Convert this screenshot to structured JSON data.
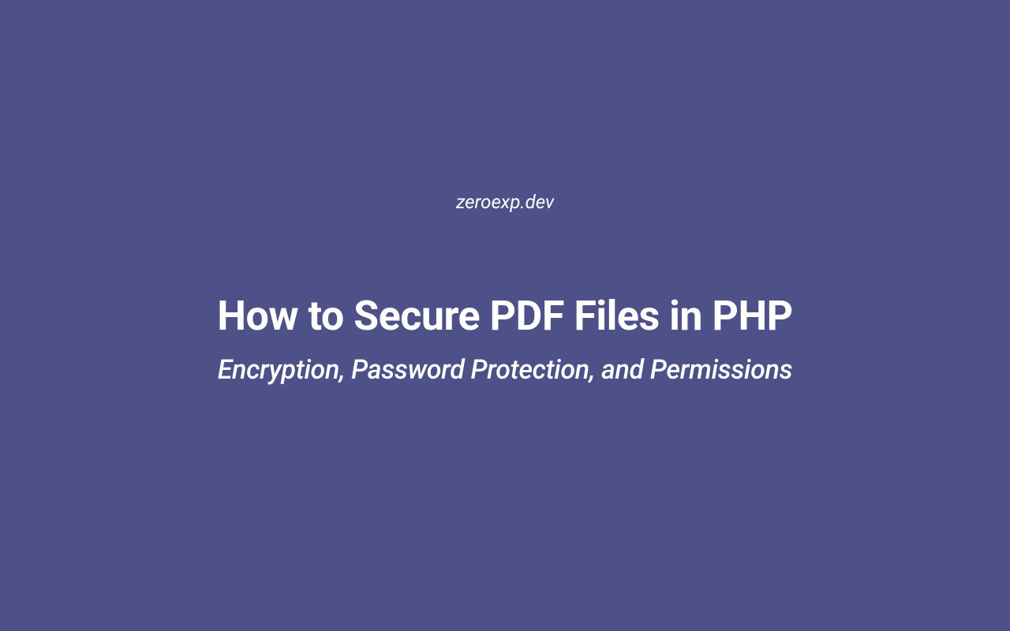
{
  "site_name": "zeroexp.dev",
  "title": "How to Secure PDF Files in PHP",
  "subtitle": "Encryption, Password Protection, and Permissions"
}
